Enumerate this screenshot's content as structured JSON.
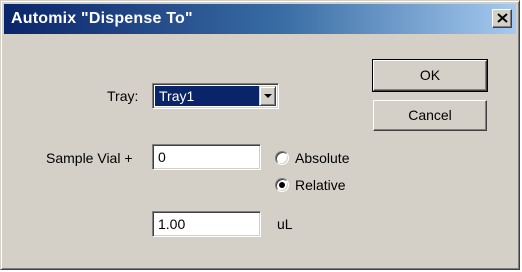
{
  "window": {
    "title": "Automix \"Dispense To\""
  },
  "tray": {
    "label": "Tray:",
    "selected": "Tray1"
  },
  "sample_vial": {
    "label": "Sample Vial +",
    "value": "0"
  },
  "mode": {
    "options": [
      "Absolute",
      "Relative"
    ],
    "selected": "Relative"
  },
  "volume": {
    "value": "1.00",
    "unit": "uL"
  },
  "buttons": {
    "ok": "OK",
    "cancel": "Cancel"
  },
  "icons": {
    "close": "close-icon",
    "dropdown": "chevron-down-icon"
  },
  "colors": {
    "titlebar_start": "#0a246a",
    "titlebar_end": "#a6caf0",
    "face": "#d4d0c8",
    "selection": "#0a246a"
  }
}
